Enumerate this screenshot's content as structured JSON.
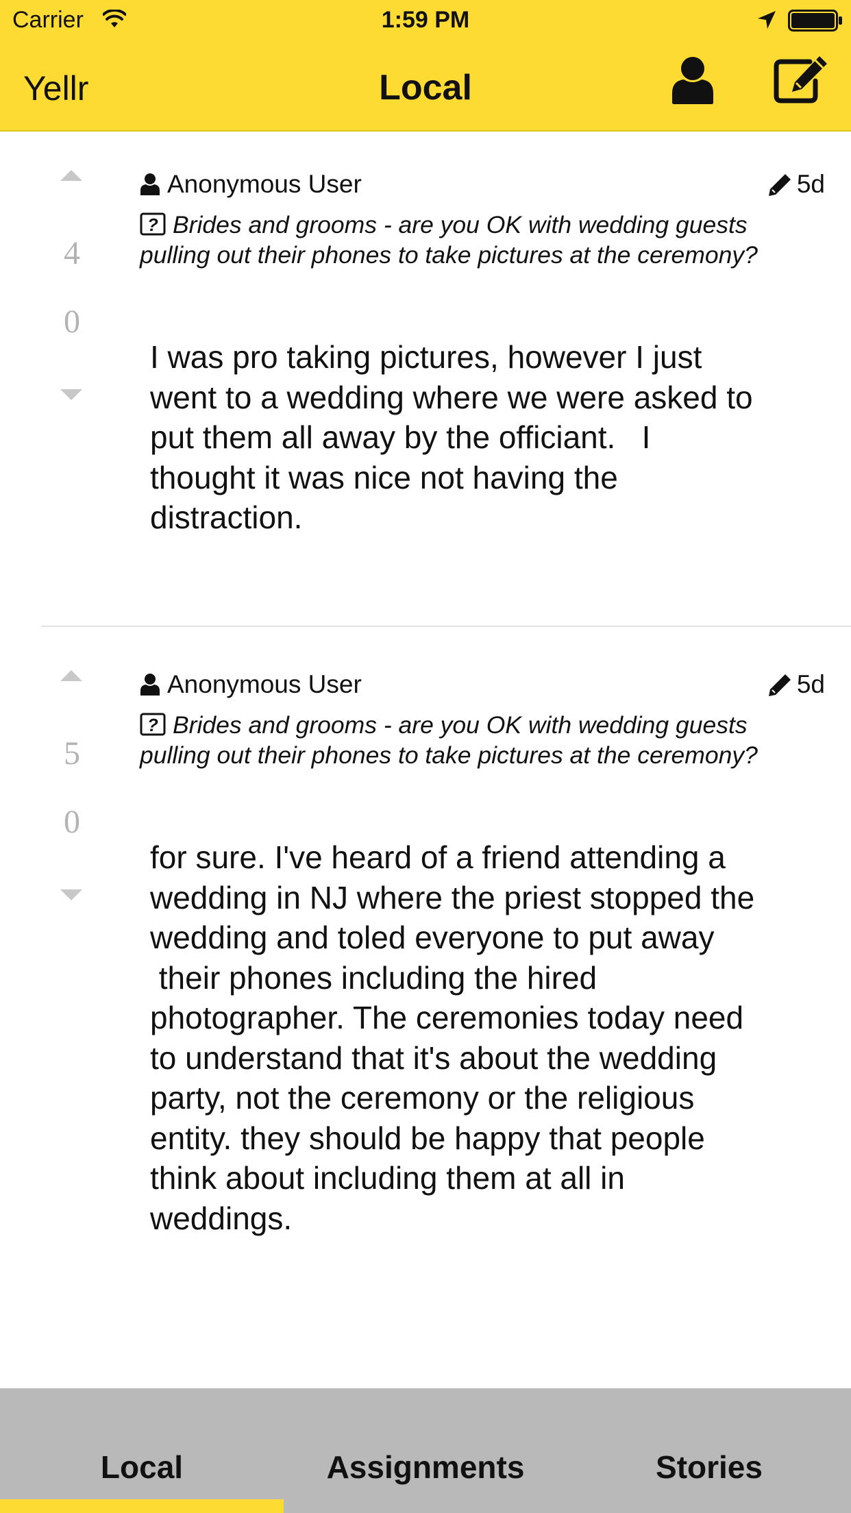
{
  "status_bar": {
    "carrier": "Carrier",
    "time": "1:59 PM",
    "icons": [
      "wifi-icon",
      "location-arrow-icon",
      "battery-icon"
    ]
  },
  "nav": {
    "brand": "Yellr",
    "title": "Local",
    "right_icons": [
      "user-profile-icon",
      "compose-icon"
    ]
  },
  "posts": [
    {
      "upvotes": "4",
      "downvotes": "0",
      "author": "Anonymous User",
      "age": "5d",
      "question": "Brides and grooms - are you OK with wedding guests pulling out their phones to take pictures at the ceremony?",
      "body": "I was pro taking pictures, however I just\nwent to a wedding where we were asked to\nput them all away by the officiant.   I\nthought it was nice not having the\ndistraction."
    },
    {
      "upvotes": "5",
      "downvotes": "0",
      "author": "Anonymous User",
      "age": "5d",
      "question": "Brides and grooms - are you OK with wedding guests pulling out their phones to take pictures at the ceremony?",
      "body": "for sure. I've heard of a friend attending a\nwedding in NJ where the priest stopped the\nwedding and toled everyone to put away\n their phones including the hired\nphotographer. The ceremonies today need\nto understand that it's about the wedding\nparty, not the ceremony or the religious\nentity. they should be happy that people\nthink about including them at all in\nweddings."
    }
  ],
  "tabs": [
    {
      "label": "Local",
      "selected": true
    },
    {
      "label": "Assignments",
      "selected": false
    },
    {
      "label": "Stories",
      "selected": false
    }
  ],
  "colors": {
    "accent": "#fedb33",
    "tab_bar": "#b9b9b9",
    "vote_gray": "#b3b3b3"
  }
}
